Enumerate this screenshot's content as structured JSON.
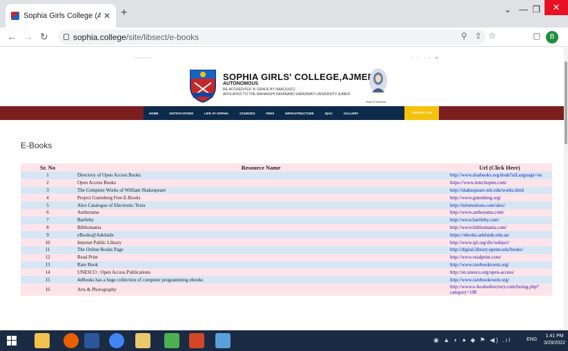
{
  "browser": {
    "tab_title": "Sophia Girls College (Autonomo",
    "url_host": "sophia.college",
    "url_path": "/site/libsect/e-books",
    "profile_initial": "B"
  },
  "site": {
    "college_name": "SOPHIA GIRLS' COLLEGE,AJMER",
    "autonomous": "AUTONOMOUS",
    "accreditation": "RE-ACCREDITED 'A' GRADE BY NAAC(UGC)",
    "affiliation": "AFFILIATED TO THE MAHARSHI DAYANAND SARASWATI UNIVERSITY, AJMER",
    "seat_text": "Seat Of Wisdom",
    "nav": [
      "HOME",
      "NOTIFICATIONS",
      "LIFE AT SOPHIA",
      "COURSES",
      "FEES",
      "INFRASTRUCTURE",
      "IQAC",
      "GALLERY"
    ],
    "contact_us": "CONTACT US",
    "page_title": "E-Books"
  },
  "table": {
    "headers": [
      "Sr. No",
      "Resource Name",
      "Url (Click Here)"
    ],
    "rows": [
      {
        "no": "1",
        "name": "Directory of Open Access Books",
        "url": "http://www.doabooks.org/doab?uiLanguage=en"
      },
      {
        "no": "2",
        "name": "Open Access Books",
        "url": "https://www.intechopen.com/"
      },
      {
        "no": "3",
        "name": "The Complete Works of William Shakespeare",
        "url": "http://shakespeare.mit.edu/works.html"
      },
      {
        "no": "4",
        "name": "Project Gutenberg Free E-Books",
        "url": "http://www.gutenberg.org/"
      },
      {
        "no": "5",
        "name": "Alex Catalogue of Electronic Texts",
        "url": "http://infomotions.com/alex/"
      },
      {
        "no": "6",
        "name": "Authorama",
        "url": "http://www.authorama.com/"
      },
      {
        "no": "7",
        "name": "Bartleby",
        "url": "http://www.bartleby.com/"
      },
      {
        "no": "8",
        "name": "Bibliomania",
        "url": "http://www.bibliomania.com/"
      },
      {
        "no": "9",
        "name": "eBooks@Adelaide",
        "url": "https://ebooks.adelaide.edu.au/"
      },
      {
        "no": "10",
        "name": "Internet Public Library",
        "url": "http://www.ipl.org/div/subject/"
      },
      {
        "no": "11",
        "name": "The Online Books Page",
        "url": "http://digital.library.upenn.edu/books/"
      },
      {
        "no": "12",
        "name": "Read Print",
        "url": "http://www.readprint.com/"
      },
      {
        "no": "13",
        "name": "Rare Book",
        "url": "http://www.rarebookroom.org/"
      },
      {
        "no": "14",
        "name": "UNESCO : Open Access Publications",
        "url": "http://en.unesco.org/open-access/"
      },
      {
        "no": "15",
        "name": "4eBooks has a huge collection of computer programming ebooks",
        "url": "http://www.rarebookroom.org/"
      },
      {
        "no": "16",
        "name": "Arts & Photography",
        "url": "http://www.e-booksdirectory.com/listing.php?category=108"
      }
    ]
  },
  "taskbar": {
    "lang": "ENG",
    "time": "1:41 PM",
    "date": "3/29/2022"
  },
  "colors": {
    "nav_maroon": "#7b1e1e",
    "nav_blue": "#0d2a4a",
    "contact_yellow": "#f4c20d",
    "row_blue": "#d6e6f5",
    "row_pink": "#fde4ea",
    "link": "#1a1aa6"
  }
}
